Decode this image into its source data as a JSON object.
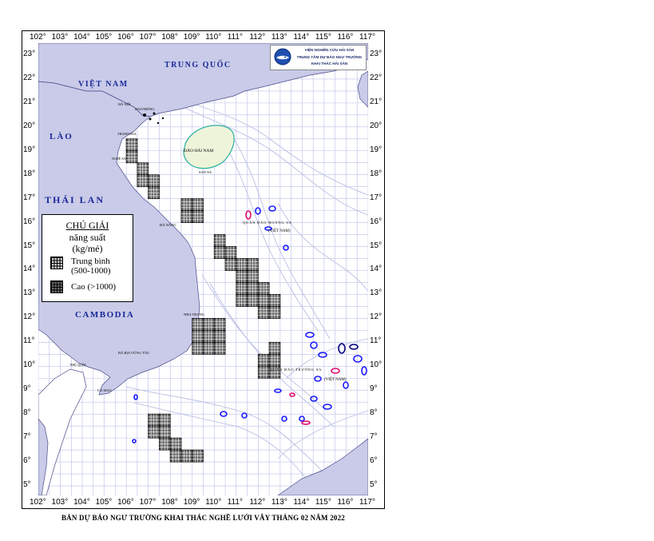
{
  "map": {
    "longitude_labels": [
      "102°",
      "103°",
      "104°",
      "105°",
      "106°",
      "107°",
      "108°",
      "109°",
      "110°",
      "111°",
      "112°",
      "113°",
      "114°",
      "115°",
      "116°",
      "117°"
    ],
    "latitude_labels": [
      "23°",
      "22°",
      "21°",
      "20°",
      "19°",
      "18°",
      "17°",
      "16°",
      "15°",
      "14°",
      "13°",
      "12°",
      "11°",
      "10°",
      "9°",
      "8°",
      "7°",
      "6°",
      "5°"
    ],
    "countries": {
      "vietnam": "VIỆT NAM",
      "china": "TRUNG QUỐC",
      "laos": "LÀO",
      "thailand": "THÁI LAN",
      "cambodia": "CAMBODIA"
    },
    "places": {
      "hainan": "ĐẢO HẢI NAM",
      "sanya": "SAN YA",
      "hanoi": "HÀ NỘI",
      "haiphong": "HẢI PHÒNG",
      "thanhhoa": "THANH HÓA",
      "nghean": "NGHỆ AN",
      "danang": "ĐÀ NẴNG",
      "nhatrang": "NHA TRANG",
      "vungtau": "BÀ RỊA VŨNG TÀU",
      "phuquoc": "PHÚ QUỐC",
      "camau": "CÀ MAU",
      "hoangsa": "QUẦN ĐẢO HOÀNG SA",
      "truongsa": "QUẦN ĐẢO TRƯỜNG SA",
      "vn_hoangsa": "(VIỆT NAM)",
      "vn_truongsa": "(VIỆT NAM)"
    },
    "colors": {
      "land": "#c9cbe8",
      "sea": "#ffffff",
      "hainan": "#eef4d9",
      "grid": "#b9bfe8",
      "medium_cells": "#d0d0d0",
      "high_cells": "#6a6a6a",
      "reef_blue": "#1a1aff",
      "reef_red": "#e0106e"
    },
    "forecast_cells": {
      "high": [
        [
          106,
          19.5
        ],
        [
          106,
          19
        ],
        [
          106.5,
          18.5
        ],
        [
          106.5,
          18
        ],
        [
          107,
          18
        ],
        [
          107,
          17.5
        ],
        [
          108.5,
          17
        ],
        [
          108.5,
          16.5
        ],
        [
          109,
          17
        ],
        [
          109,
          16.5
        ],
        [
          110,
          15.5
        ],
        [
          110,
          15
        ],
        [
          110.5,
          15
        ],
        [
          110.5,
          14.5
        ],
        [
          111,
          14.5
        ],
        [
          111,
          14
        ],
        [
          111.5,
          14.5
        ],
        [
          111.5,
          14
        ],
        [
          111,
          13.5
        ],
        [
          111,
          13
        ],
        [
          111.5,
          13.5
        ],
        [
          111.5,
          13
        ],
        [
          112,
          13.5
        ],
        [
          112,
          13
        ],
        [
          112,
          12.5
        ],
        [
          112.5,
          13
        ],
        [
          112.5,
          12.5
        ],
        [
          109,
          12
        ],
        [
          109.5,
          12
        ],
        [
          109,
          11.5
        ],
        [
          109.5,
          11.5
        ],
        [
          110,
          11.5
        ],
        [
          110,
          12
        ],
        [
          109,
          11
        ],
        [
          109.5,
          11
        ],
        [
          110,
          11
        ],
        [
          112,
          10.5
        ],
        [
          112,
          10
        ],
        [
          112.5,
          10.5
        ],
        [
          112.5,
          10
        ],
        [
          112.5,
          11
        ],
        [
          107,
          8
        ],
        [
          107,
          7.5
        ],
        [
          107.5,
          8
        ],
        [
          107.5,
          7.5
        ],
        [
          107.5,
          7
        ],
        [
          108,
          7
        ],
        [
          108,
          6.5
        ],
        [
          108.5,
          6.5
        ],
        [
          109,
          6.5
        ]
      ]
    },
    "islands_label": "Hoàng Sa / Trường Sa"
  },
  "legend": {
    "title": "CHÚ GIẢI",
    "subtitle_line1": "năng suất",
    "subtitle_line2": "(kg/mẻ)",
    "items": [
      {
        "label_line1": "Trung bình",
        "label_line2": "(500-1000)"
      },
      {
        "label_line1": "Cao (>1000)",
        "label_line2": ""
      }
    ]
  },
  "agency": {
    "line1": "VIỆN NGHIÊN CỨU HẢI SẢN",
    "line2": "TRUNG TÂM DỰ BÁO NGƯ TRƯỜNG",
    "line3": "KHAI THÁC HẢI SẢN"
  },
  "caption": "BẢN DỰ BÁO NGƯ TRƯỜNG KHAI THÁC NGHỀ LƯỚI VÂY THÁNG 02 NĂM 2022"
}
